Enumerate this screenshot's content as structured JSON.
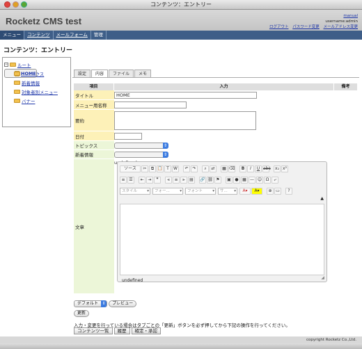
{
  "window": {
    "title": "コンテンツ：エントリー"
  },
  "header": {
    "site_title": "Rocketz CMS test",
    "manual_link": "manual",
    "username": "username:admin",
    "links": [
      "ログアウト",
      "パスワード変更",
      "メールアドレス変更"
    ]
  },
  "nav": [
    "メニュー",
    "コンテンツ",
    "メールフォーム",
    "管理"
  ],
  "page_title": "コンテンツ：エントリー",
  "tree": {
    "root": "ルート",
    "items": [
      "HOME",
      "トピックス",
      "新着情報",
      "対象者別メニュー",
      "バナー"
    ]
  },
  "tabs": [
    "設定",
    "内容",
    "ファイル",
    "メモ"
  ],
  "table": {
    "headers": [
      "項目",
      "入力",
      "備考"
    ],
    "rows": [
      {
        "label": "タイトル",
        "value": "HOME"
      },
      {
        "label": "メニュー用名称",
        "value": ""
      },
      {
        "label": "要約",
        "value": ""
      },
      {
        "label": "日付",
        "value": ""
      },
      {
        "label": "トピックス",
        "value": ""
      },
      {
        "label": "新着情報",
        "value": ""
      },
      {
        "label": "文章",
        "value": "undefined"
      }
    ]
  },
  "editor": {
    "source_label": "ソース",
    "style_placeholder": "スタイル",
    "format_placeholder": "フォー...",
    "font_placeholder": "フォント",
    "size_placeholder": "サ...",
    "footer": "undefined"
  },
  "controls": {
    "default_select": "デフォルト",
    "preview": "プレビュー",
    "update": "更新"
  },
  "notice": "入力・変更を行っている場合はタブごとの「更新」ボタンを必ず押してから下記の操作を行ってください。",
  "actions": [
    "コンテンツ一覧",
    "履歴",
    "確定・承認"
  ],
  "footer": "copyright Rocketz Co.,Ltd.",
  "colors": {
    "nav_bg": "#3e5e88",
    "required_label": "#fdf1b8",
    "optional_label": "#ecf6d8"
  }
}
